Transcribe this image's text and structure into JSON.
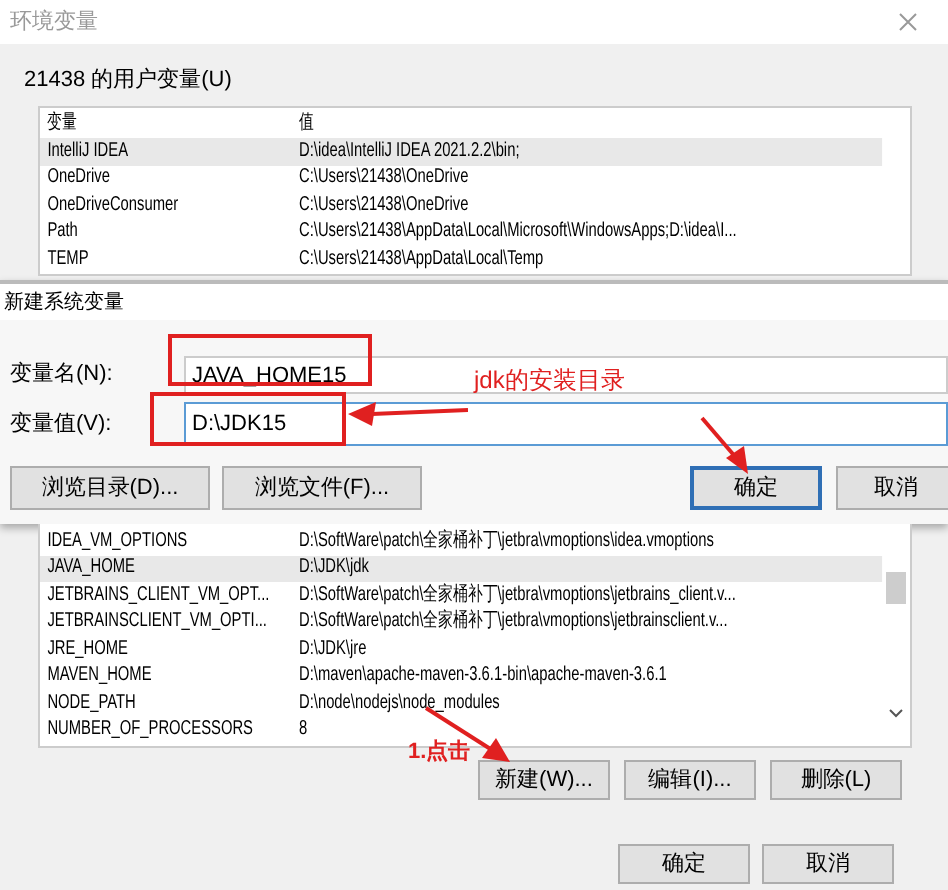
{
  "window": {
    "title": "环境变量"
  },
  "user_vars": {
    "label": "21438 的用户变量(U)",
    "columns": [
      "变量",
      "值"
    ],
    "rows": [
      {
        "name": "IntelliJ IDEA",
        "value": "D:\\idea\\IntelliJ IDEA 2021.2.2\\bin;",
        "selected": true
      },
      {
        "name": "OneDrive",
        "value": "C:\\Users\\21438\\OneDrive",
        "selected": false
      },
      {
        "name": "OneDriveConsumer",
        "value": "C:\\Users\\21438\\OneDrive",
        "selected": false
      },
      {
        "name": "Path",
        "value": "C:\\Users\\21438\\AppData\\Local\\Microsoft\\WindowsApps;D:\\idea\\I...",
        "selected": false
      },
      {
        "name": "TEMP",
        "value": "C:\\Users\\21438\\AppData\\Local\\Temp",
        "selected": false
      }
    ]
  },
  "dialog": {
    "title": "新建系统变量",
    "name_label": "变量名(N):",
    "name_value": "JAVA_HOME15",
    "value_label": "变量值(V):",
    "value_value": "D:\\JDK15",
    "buttons": [
      {
        "label": "浏览目录(D)...",
        "kind": "normal"
      },
      {
        "label": "浏览文件(F)...",
        "kind": "normal"
      },
      {
        "label": "确定",
        "kind": "default"
      },
      {
        "label": "取消",
        "kind": "normal"
      }
    ]
  },
  "system_vars": {
    "rows": [
      {
        "name": "IDEA_VM_OPTIONS",
        "value": "D:\\SoftWare\\patch\\全家桶补丁\\jetbra\\vmoptions\\idea.vmoptions",
        "selected": false
      },
      {
        "name": "JAVA_HOME",
        "value": "D:\\JDK\\jdk",
        "selected": true
      },
      {
        "name": "JETBRAINS_CLIENT_VM_OPT...",
        "value": "D:\\SoftWare\\patch\\全家桶补丁\\jetbra\\vmoptions\\jetbrains_client.v...",
        "selected": false
      },
      {
        "name": "JETBRAINSCLIENT_VM_OPTI...",
        "value": "D:\\SoftWare\\patch\\全家桶补丁\\jetbra\\vmoptions\\jetbrainsclient.v...",
        "selected": false
      },
      {
        "name": "JRE_HOME",
        "value": "D:\\JDK\\jre",
        "selected": false
      },
      {
        "name": "MAVEN_HOME",
        "value": "D:\\maven\\apache-maven-3.6.1-bin\\apache-maven-3.6.1",
        "selected": false
      },
      {
        "name": "NODE_PATH",
        "value": "D:\\node\\nodejs\\node_modules",
        "selected": false
      },
      {
        "name": "NUMBER_OF_PROCESSORS",
        "value": "8",
        "selected": false
      }
    ],
    "buttons": [
      "新建(W)...",
      "编辑(I)...",
      "删除(L)"
    ]
  },
  "footer_buttons": [
    "确定",
    "取消"
  ],
  "annotations": [
    {
      "kind": "value-note",
      "text": "jdk的安装目录"
    },
    {
      "kind": "new-note",
      "text": "1.点击"
    }
  ]
}
